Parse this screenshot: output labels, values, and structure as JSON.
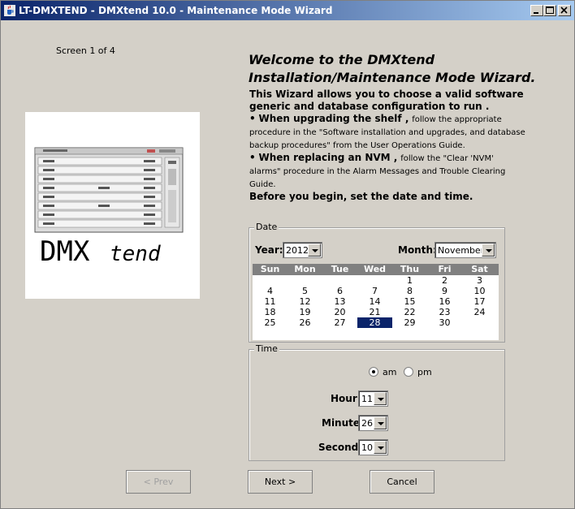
{
  "window": {
    "title": "LT-DMXTEND - DMXtend 10.0 - Maintenance Mode Wizard"
  },
  "screen_label": "Screen 1 of 4",
  "logo": {
    "text": "DMXtend"
  },
  "heading": {
    "line1": "Welcome to the DMXtend",
    "line2": "Installation/Maintenance Mode Wizard."
  },
  "intro": {
    "p1": "This Wizard allows you to choose a valid software generic and database configuration to run .",
    "p2_bold": "When upgrading the shelf ,",
    "p2_rest": "follow the appropriate procedure in the \"Software installation and upgrades, and database backup procedures\" from the User Operations Guide.",
    "p3_bold": "When replacing an NVM ,",
    "p3_rest": "follow the \"Clear 'NVM' alarms\" procedure in the Alarm Messages and Trouble Clearing Guide.",
    "p4": "Before you begin, set the date and time."
  },
  "date": {
    "group_label": "Date",
    "year_label": "Year:",
    "year_value": "2012",
    "month_label": "Month:",
    "month_value": "November",
    "weekdays": [
      "Sun",
      "Mon",
      "Tue",
      "Wed",
      "Thu",
      "Fri",
      "Sat"
    ],
    "weeks": [
      [
        "",
        "",
        "",
        "",
        "1",
        "2",
        "3"
      ],
      [
        "4",
        "5",
        "6",
        "7",
        "8",
        "9",
        "10"
      ],
      [
        "11",
        "12",
        "13",
        "14",
        "15",
        "16",
        "17"
      ],
      [
        "18",
        "19",
        "20",
        "21",
        "22",
        "23",
        "24"
      ],
      [
        "25",
        "26",
        "27",
        "28",
        "29",
        "30",
        ""
      ]
    ],
    "selected_day": "28"
  },
  "time": {
    "group_label": "Time",
    "am_label": "am",
    "pm_label": "pm",
    "selected_period": "am",
    "hour_label": "Hour:",
    "hour_value": "11",
    "minute_label": "Minute:",
    "minute_value": "26",
    "second_label": "Second:",
    "second_value": "10"
  },
  "buttons": {
    "prev": "< Prev",
    "next": "Next >",
    "cancel": "Cancel"
  },
  "colors": {
    "titlebar_start": "#0a246a",
    "titlebar_end": "#a6caf0",
    "selection": "#0a246a",
    "calendar_header": "#808080"
  }
}
